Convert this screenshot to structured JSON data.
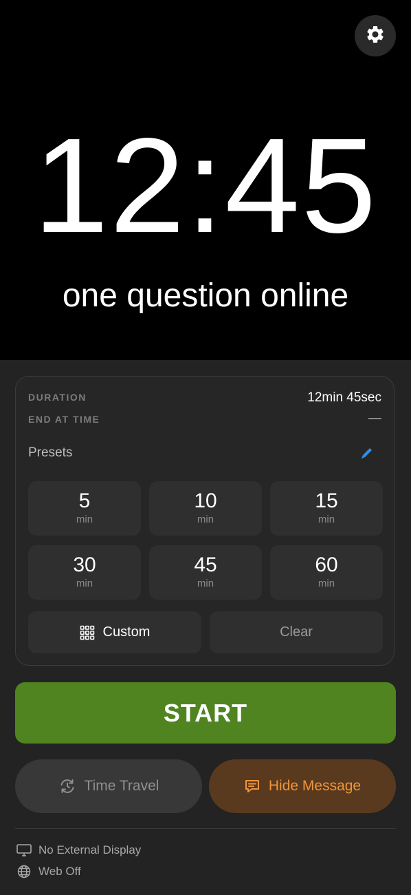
{
  "header": {
    "settings_icon": "gear-icon"
  },
  "timer": {
    "time": "12:45",
    "message": "one question online"
  },
  "panel": {
    "duration_label": "DURATION",
    "duration_value": "12min 45sec",
    "end_label": "END AT TIME",
    "end_value": "—",
    "presets_label": "Presets",
    "presets": [
      {
        "value": "5",
        "unit": "min"
      },
      {
        "value": "10",
        "unit": "min"
      },
      {
        "value": "15",
        "unit": "min"
      },
      {
        "value": "30",
        "unit": "min"
      },
      {
        "value": "45",
        "unit": "min"
      },
      {
        "value": "60",
        "unit": "min"
      }
    ],
    "custom_label": "Custom",
    "clear_label": "Clear"
  },
  "actions": {
    "start_label": "START",
    "time_travel_label": "Time Travel",
    "hide_message_label": "Hide Message"
  },
  "status": {
    "display": "No External Display",
    "web": "Web Off"
  },
  "colors": {
    "start": "#4f8420",
    "hide_message_bg": "#5a3a1e",
    "hide_message_text": "#f0943c",
    "pencil": "#2f8de4"
  }
}
